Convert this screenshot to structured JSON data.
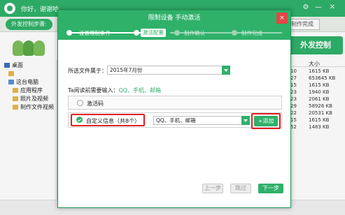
{
  "app": {
    "greeting": "你好，谢谢哈",
    "steps_label": "外发控制步骤:",
    "steps_right": "制作完成",
    "big_button": "外发控制",
    "tree": [
      "桌面",
      "这台电脑",
      "应用程序",
      "照片及视频",
      "制作文件视频"
    ],
    "list": {
      "header_col": "大小",
      "rows": [
        {
          "a": "10",
          "b": "1615 KB"
        },
        {
          "a": "27",
          "b": "653645 KB"
        },
        {
          "a": "15",
          "b": "1615 KB"
        },
        {
          "a": "23",
          "b": "1940 KB"
        },
        {
          "a": "23",
          "b": "2061 KB"
        },
        {
          "a": "29",
          "b": "58926 KB"
        },
        {
          "a": "22",
          "b": "20531 KB"
        },
        {
          "a": "15",
          "b": "1615 KB"
        },
        {
          "a": "52",
          "b": "1483 KB"
        }
      ]
    }
  },
  "modal": {
    "title": "限制设备 手动激活",
    "close": "×",
    "steps": [
      {
        "label": "设置限制条件",
        "state": "done"
      },
      {
        "label": "激活配置",
        "state": "active"
      },
      {
        "label": "制作确认",
        "state": "pending"
      },
      {
        "label": "制作完成",
        "state": "pending"
      }
    ],
    "file_belongs_label": "所选文件属于：",
    "file_belongs_value": "2015年7月份",
    "input_hint_prefix": "Ta阅读前需要输入：",
    "input_hint_value": "QQ、手机、邮箱",
    "option_activation_code": "激活码",
    "option_custom_info": "自定义信息（共8个）",
    "custom_info_value": "QQ、手机、邮箱",
    "add_button": "+添加",
    "prev_button": "上一步",
    "skip_button": "跳过",
    "next_button": "下一步"
  },
  "colors": {
    "accent": "#2fb16a",
    "highlight": "#e02020"
  }
}
